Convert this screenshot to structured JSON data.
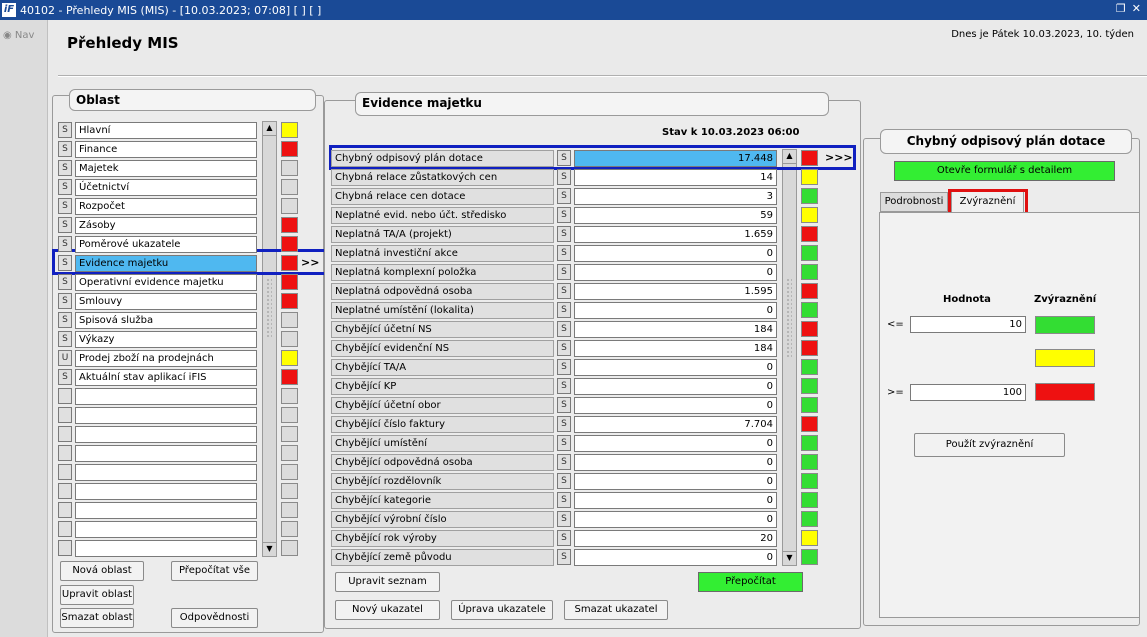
{
  "window": {
    "title": "40102 - Přehledy MIS (MIS) - [10.03.2023; 07:08]  [ ]  [ ]"
  },
  "nav": {
    "label": "Nav"
  },
  "header": {
    "title": "Přehledy MIS",
    "date_text": "Dnes je Pátek   10.03.2023, 10. týden"
  },
  "oblast": {
    "title": "Oblast",
    "items": [
      {
        "s": "S",
        "label": "Hlavní",
        "color": "#ffff00"
      },
      {
        "s": "S",
        "label": "Finance",
        "color": "#ee1111"
      },
      {
        "s": "S",
        "label": "Majetek",
        "color": "#dcdcdc"
      },
      {
        "s": "S",
        "label": "Účetnictví",
        "color": "#dcdcdc"
      },
      {
        "s": "S",
        "label": "Rozpočet",
        "color": "#dcdcdc"
      },
      {
        "s": "S",
        "label": "Zásoby",
        "color": "#ee1111"
      },
      {
        "s": "S",
        "label": "Poměrové ukazatele",
        "color": "#ee1111"
      },
      {
        "s": "S",
        "label": "Evidence majetku",
        "color": "#ee1111"
      },
      {
        "s": "S",
        "label": "Operativní evidence majetku",
        "color": "#ee1111"
      },
      {
        "s": "S",
        "label": "Smlouvy",
        "color": "#ee1111"
      },
      {
        "s": "S",
        "label": "Spisová služba",
        "color": "#dcdcdc"
      },
      {
        "s": "S",
        "label": "Výkazy",
        "color": "#dcdcdc"
      },
      {
        "s": "U",
        "label": "Prodej zboží na prodejnách",
        "color": "#ffff00"
      },
      {
        "s": "S",
        "label": "Aktuální stav aplikací iFIS",
        "color": "#ee1111"
      }
    ],
    "empty_rows": 9,
    "selected_arrow": ">>",
    "buttons": {
      "nova": "Nová oblast",
      "prepocitat_vse": "Přepočítat vše",
      "upravit": "Upravit oblast",
      "smazat": "Smazat oblast",
      "odpovednosti": "Odpovědnosti"
    }
  },
  "evidence": {
    "title": "Evidence majetku",
    "stav": "Stav k 10.03.2023 06:00",
    "selected_arrow": ">>>",
    "items": [
      {
        "label": "Chybný odpisový plán dotace",
        "s": "S",
        "value": "17.448",
        "color": "#ee1111"
      },
      {
        "label": "Chybná relace zůstatkových cen",
        "s": "S",
        "value": "14",
        "color": "#ffff00"
      },
      {
        "label": "Chybná relace cen dotace",
        "s": "S",
        "value": "3",
        "color": "#33dd33"
      },
      {
        "label": "Neplatné evid. nebo účt. středisko",
        "s": "S",
        "value": "59",
        "color": "#ffff00"
      },
      {
        "label": "Neplatná TA/A (projekt)",
        "s": "S",
        "value": "1.659",
        "color": "#ee1111"
      },
      {
        "label": "Neplatná investiční akce",
        "s": "S",
        "value": "0",
        "color": "#33dd33"
      },
      {
        "label": "Neplatná komplexní položka",
        "s": "S",
        "value": "0",
        "color": "#33dd33"
      },
      {
        "label": "Neplatná odpovědná osoba",
        "s": "S",
        "value": "1.595",
        "color": "#ee1111"
      },
      {
        "label": "Neplatné umístění (lokalita)",
        "s": "S",
        "value": "0",
        "color": "#33dd33"
      },
      {
        "label": "Chybějící účetní NS",
        "s": "S",
        "value": "184",
        "color": "#ee1111"
      },
      {
        "label": "Chybějící evidenční NS",
        "s": "S",
        "value": "184",
        "color": "#ee1111"
      },
      {
        "label": "Chybějící TA/A",
        "s": "S",
        "value": "0",
        "color": "#33dd33"
      },
      {
        "label": "Chybějící KP",
        "s": "S",
        "value": "0",
        "color": "#33dd33"
      },
      {
        "label": "Chybějící účetní obor",
        "s": "S",
        "value": "0",
        "color": "#33dd33"
      },
      {
        "label": "Chybějící číslo faktury",
        "s": "S",
        "value": "7.704",
        "color": "#ee1111"
      },
      {
        "label": "Chybějící umístění",
        "s": "S",
        "value": "0",
        "color": "#33dd33"
      },
      {
        "label": "Chybějící odpovědná osoba",
        "s": "S",
        "value": "0",
        "color": "#33dd33"
      },
      {
        "label": "Chybějící rozdělovník",
        "s": "S",
        "value": "0",
        "color": "#33dd33"
      },
      {
        "label": "Chybějící kategorie",
        "s": "S",
        "value": "0",
        "color": "#33dd33"
      },
      {
        "label": "Chybějící výrobní číslo",
        "s": "S",
        "value": "0",
        "color": "#33dd33"
      },
      {
        "label": "Chybějící rok výroby",
        "s": "S",
        "value": "20",
        "color": "#ffff00"
      },
      {
        "label": "Chybějící země původu",
        "s": "S",
        "value": "0",
        "color": "#33dd33"
      }
    ],
    "buttons": {
      "upravit_seznam": "Upravit seznam",
      "prepocitat": "Přepočítat",
      "novy": "Nový ukazatel",
      "uprava": "Úprava ukazatele",
      "smazat": "Smazat ukazatel"
    }
  },
  "detail": {
    "title": "Chybný odpisový plán dotace",
    "open_button": "Otevře formulář s detailem",
    "tabs": {
      "podrobnosti": "Podrobnosti",
      "zvyrazneni": "Zvýraznění"
    },
    "col_hodnota": "Hodnota",
    "col_zvyrazneni": "Zvýraznění",
    "le_label": "<=",
    "ge_label": ">=",
    "le_value": "10",
    "ge_value": "100",
    "colors": {
      "low": "#33dd33",
      "mid": "#ffff00",
      "high": "#ee1111"
    },
    "apply_button": "Použít zvýraznění"
  }
}
